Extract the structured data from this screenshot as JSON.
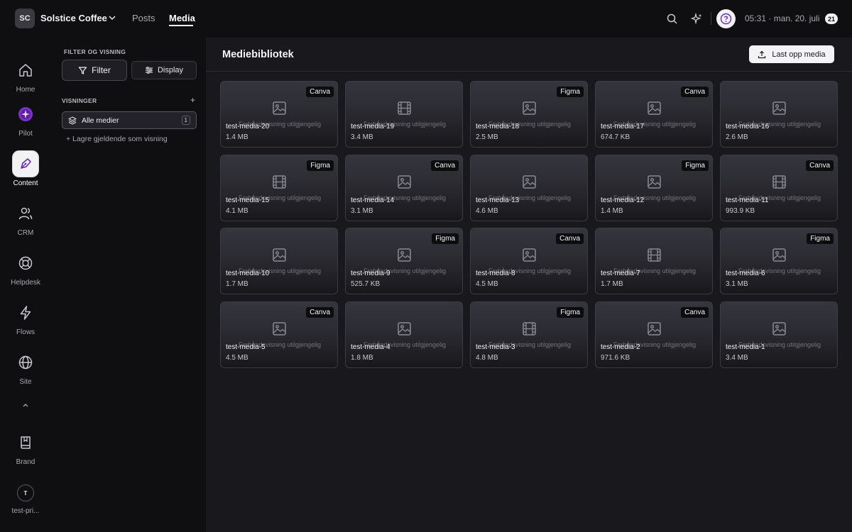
{
  "header": {
    "org_initials": "SC",
    "org_name": "Solstice Coffee",
    "nav": [
      "Posts",
      "Media"
    ],
    "active_nav": "Media",
    "clock": "05:31 · man. 20. juli",
    "date_badge": "21"
  },
  "rail": {
    "items": [
      {
        "label": "Home",
        "icon": "home-icon"
      },
      {
        "label": "Pilot",
        "icon": "pilot-icon"
      },
      {
        "label": "Content",
        "icon": "pen-icon",
        "active": true
      },
      {
        "label": "CRM",
        "icon": "users-icon"
      },
      {
        "label": "Helpdesk",
        "icon": "lifebuoy-icon"
      },
      {
        "label": "Flows",
        "icon": "bolt-icon"
      },
      {
        "label": "Site",
        "icon": "globe-icon"
      }
    ],
    "brand_label": "Brand",
    "user_initial": "T",
    "user_label": "test-pri..."
  },
  "panel": {
    "heading": "FILTER OG VISNING",
    "filter_label": "Filter",
    "display_label": "Display",
    "views_heading": "VISNINGER",
    "view_label": "Alle medier",
    "view_count": "1",
    "save_view_label": "+ Lagre gjeldende som visning"
  },
  "main": {
    "title": "Mediebibliotek",
    "upload_label": "Last opp media",
    "unavailable_text": "Forhåndsvisning utilgjengelig",
    "media": [
      {
        "name": "test-media-20",
        "size": "1.4 MB",
        "source": "Canva",
        "kind": "image"
      },
      {
        "name": "test-media-19",
        "size": "3.4 MB",
        "source": "",
        "kind": "video"
      },
      {
        "name": "test-media-18",
        "size": "2.5 MB",
        "source": "Figma",
        "kind": "image"
      },
      {
        "name": "test-media-17",
        "size": "674.7 KB",
        "source": "Canva",
        "kind": "image"
      },
      {
        "name": "test-media-16",
        "size": "2.6 MB",
        "source": "",
        "kind": "image"
      },
      {
        "name": "test-media-15",
        "size": "4.1 MB",
        "source": "Figma",
        "kind": "video"
      },
      {
        "name": "test-media-14",
        "size": "3.1 MB",
        "source": "Canva",
        "kind": "image"
      },
      {
        "name": "test-media-13",
        "size": "4.6 MB",
        "source": "",
        "kind": "image"
      },
      {
        "name": "test-media-12",
        "size": "1.4 MB",
        "source": "Figma",
        "kind": "image"
      },
      {
        "name": "test-media-11",
        "size": "993.9 KB",
        "source": "Canva",
        "kind": "video"
      },
      {
        "name": "test-media-10",
        "size": "1.7 MB",
        "source": "",
        "kind": "image"
      },
      {
        "name": "test-media-9",
        "size": "525.7 KB",
        "source": "Figma",
        "kind": "image"
      },
      {
        "name": "test-media-8",
        "size": "4.5 MB",
        "source": "Canva",
        "kind": "image"
      },
      {
        "name": "test-media-7",
        "size": "1.7 MB",
        "source": "",
        "kind": "video"
      },
      {
        "name": "test-media-6",
        "size": "3.1 MB",
        "source": "Figma",
        "kind": "image"
      },
      {
        "name": "test-media-5",
        "size": "4.5 MB",
        "source": "Canva",
        "kind": "image"
      },
      {
        "name": "test-media-4",
        "size": "1.8 MB",
        "source": "",
        "kind": "image"
      },
      {
        "name": "test-media-3",
        "size": "4.8 MB",
        "source": "Figma",
        "kind": "video"
      },
      {
        "name": "test-media-2",
        "size": "971.6 KB",
        "source": "Canva",
        "kind": "image"
      },
      {
        "name": "test-media-1",
        "size": "3.4 MB",
        "source": "",
        "kind": "image"
      }
    ]
  },
  "colors": {
    "background": "#0f0f12",
    "main_background": "#18181d",
    "card_border": "#3b3b42",
    "accent_pilot": "#8b3fd6"
  }
}
